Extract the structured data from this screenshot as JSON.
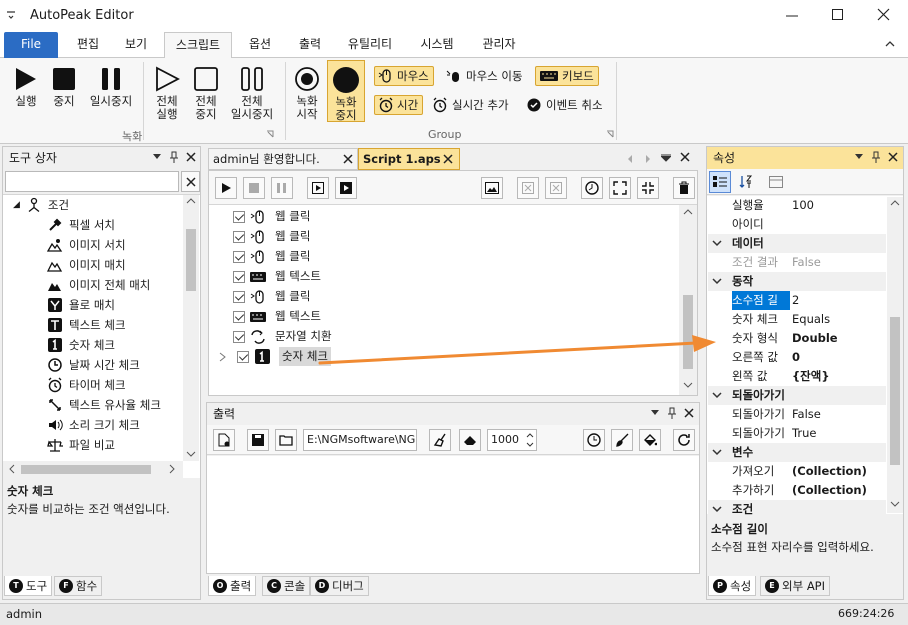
{
  "window": {
    "title": "AutoPeak Editor"
  },
  "menu": {
    "file": "File",
    "tabs": [
      "편집",
      "보기",
      "스크립트",
      "옵션",
      "출력",
      "유틸리티",
      "시스템",
      "관리자"
    ]
  },
  "ribbon": {
    "rec_group": {
      "run": "실행",
      "stop": "중지",
      "pause": "일시중지",
      "run_all_1": "전체",
      "run_all_2": "실행",
      "stop_all_1": "전체",
      "stop_all_2": "중지",
      "pause_all_1": "전체",
      "pause_all_2": "일시중지",
      "label": "녹화"
    },
    "rec2": {
      "start_1": "녹화",
      "start_2": "시작",
      "stop_1": "녹화",
      "stop_2": "중지"
    },
    "group": {
      "mouse": "마우스",
      "mouse_move": "마우스 이동",
      "keyboard": "키보드",
      "time": "시간",
      "realtime_add": "실시간 추가",
      "event_cancel": "이벤트 취소",
      "label": "Group"
    }
  },
  "toolbox": {
    "title": "도구 상자",
    "root": "조건",
    "items": [
      "픽셀 서치",
      "이미지 서치",
      "이미지 매치",
      "이미지 전체 매치",
      "욜로 매치",
      "텍스트 체크",
      "숫자 체크",
      "날짜 시간 체크",
      "타이머 체크",
      "텍스트 유사율 체크",
      "소리 크기 체크",
      "파일 비교"
    ],
    "desc_title": "숫자 체크",
    "desc_text": "숫자를 비교하는 조건 액션입니다.",
    "tab_tools": "도구",
    "tab_funcs": "함수"
  },
  "doc_tabs": [
    {
      "label": "admin님 환영합니다."
    },
    {
      "label": "Script 1.aps"
    }
  ],
  "script": {
    "rows": [
      {
        "icon": "mouse",
        "label": "웹 클릭"
      },
      {
        "icon": "mouse",
        "label": "웹 클릭"
      },
      {
        "icon": "mouse",
        "label": "웹 클릭"
      },
      {
        "icon": "keyboard",
        "label": "웹 텍스트"
      },
      {
        "icon": "mouse",
        "label": "웹 클릭"
      },
      {
        "icon": "keyboard",
        "label": "웹 텍스트"
      },
      {
        "icon": "replace",
        "label": "문자열 치환"
      },
      {
        "icon": "number",
        "label": "숫자 체크"
      }
    ]
  },
  "output": {
    "title": "출력",
    "path": "E:\\NGMsoftware\\NG",
    "interval": "1000",
    "tab_output": "출력",
    "tab_console": "콘솔",
    "tab_debug": "디버그"
  },
  "properties": {
    "title": "속성",
    "top_rows": [
      {
        "k": "실행율",
        "v": "100"
      },
      {
        "k": "아이디",
        "v": ""
      }
    ],
    "cat_data": "데이터",
    "data_rows": [
      {
        "k": "조건 결과",
        "v": "False"
      }
    ],
    "cat_action": "동작",
    "action_rows": [
      {
        "k": "소수점 길",
        "v": "2"
      },
      {
        "k": "숫자 체크",
        "v": "Equals"
      },
      {
        "k": "숫자 형식",
        "v": "Double"
      },
      {
        "k": "오른쪽 값",
        "v": "0"
      },
      {
        "k": "왼쪽 값",
        "v": "{잔액}"
      }
    ],
    "cat_return": "되돌아가기",
    "return_rows": [
      {
        "k": "되돌아가기",
        "v": "False"
      },
      {
        "k": "되돌아가기",
        "v": "True"
      }
    ],
    "cat_vars": "변수",
    "var_rows": [
      {
        "k": "가져오기",
        "v": "(Collection)"
      },
      {
        "k": "추가하기",
        "v": "(Collection)"
      }
    ],
    "cat_cond": "조건",
    "desc_title": "소수점 길이",
    "desc_text": "소수점 표현 자리수를 입력하세요.",
    "tab_props": "속성",
    "tab_api": "외부 API"
  },
  "status": {
    "user": "admin",
    "time": "669:24:26"
  },
  "colors": {
    "accent": "#2b6cc4",
    "highlight": "#fbe39a",
    "arrow": "#f08a32",
    "selection": "#0078d7"
  }
}
